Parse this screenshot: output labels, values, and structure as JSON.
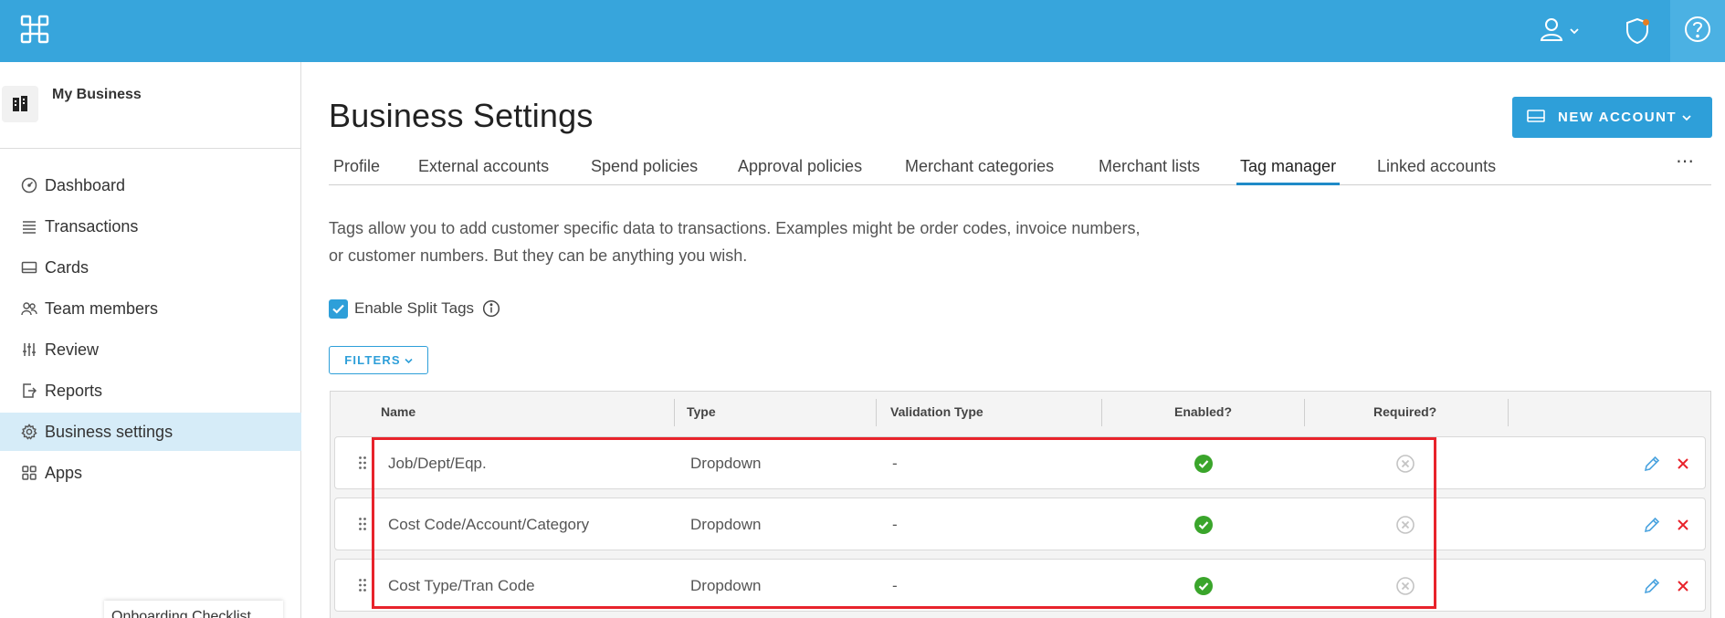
{
  "topbar": {
    "logo_icon": "grid-logo-icon",
    "user_icon": "user-icon",
    "shield_icon": "shield-icon",
    "help_icon": "help-icon",
    "notification_color": "#e67e22"
  },
  "sidebar": {
    "business_name": "My Business",
    "items": [
      {
        "label": "Dashboard",
        "icon": "dashboard-icon"
      },
      {
        "label": "Transactions",
        "icon": "list-icon"
      },
      {
        "label": "Cards",
        "icon": "card-icon"
      },
      {
        "label": "Team members",
        "icon": "team-icon"
      },
      {
        "label": "Review",
        "icon": "sliders-icon"
      },
      {
        "label": "Reports",
        "icon": "export-icon"
      },
      {
        "label": "Business settings",
        "icon": "gear-icon",
        "active": true
      },
      {
        "label": "Apps",
        "icon": "apps-icon"
      }
    ],
    "onboarding_label": "Onboarding Checklist"
  },
  "header": {
    "title": "Business Settings",
    "new_account_label": "NEW ACCOUNT"
  },
  "tabs": [
    {
      "label": "Profile"
    },
    {
      "label": "External accounts"
    },
    {
      "label": "Spend policies"
    },
    {
      "label": "Approval policies"
    },
    {
      "label": "Merchant categories"
    },
    {
      "label": "Merchant lists"
    },
    {
      "label": "Tag manager",
      "active": true
    },
    {
      "label": "Linked accounts"
    }
  ],
  "more_label": "⋯",
  "description": "Tags allow you to add customer specific data to transactions. Examples might be order codes, invoice numbers, or customer numbers. But they can be anything you wish.",
  "split_tags": {
    "label": "Enable Split Tags",
    "checked": true
  },
  "filters_label": "FILTERS",
  "table": {
    "columns": [
      "Name",
      "Type",
      "Validation Type",
      "Enabled?",
      "Required?"
    ],
    "rows": [
      {
        "name": "Job/Dept/Eqp.",
        "type": "Dropdown",
        "validation": "-",
        "enabled": true,
        "required": false
      },
      {
        "name": "Cost Code/Account/Category",
        "type": "Dropdown",
        "validation": "-",
        "enabled": true,
        "required": false
      },
      {
        "name": "Cost Type/Tran Code",
        "type": "Dropdown",
        "validation": "-",
        "enabled": true,
        "required": false
      }
    ]
  },
  "colors": {
    "topbar": "#37a5dc",
    "accent": "#2e9fd9",
    "enabled_green": "#3aa52b",
    "disabled_gray": "#c4c4c4",
    "delete_red": "#e8232b",
    "highlight_red": "#e8232b"
  }
}
